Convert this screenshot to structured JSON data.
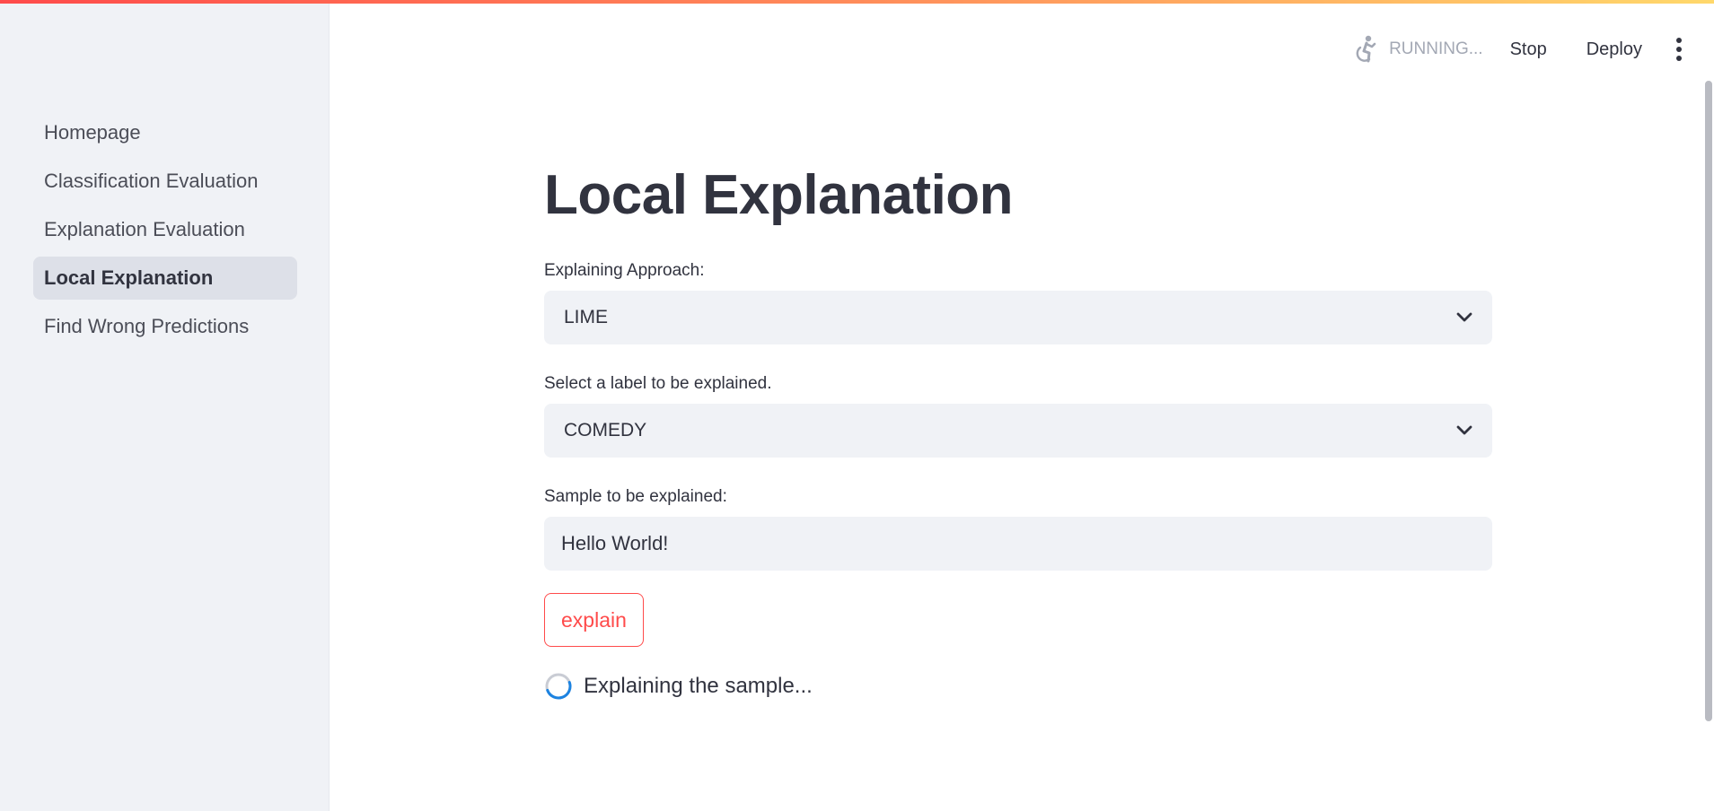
{
  "sidebar": {
    "items": [
      {
        "label": "Homepage"
      },
      {
        "label": "Classification Evaluation"
      },
      {
        "label": "Explanation Evaluation"
      },
      {
        "label": "Local Explanation",
        "active": true
      },
      {
        "label": "Find Wrong Predictions"
      }
    ]
  },
  "toolbar": {
    "status": "RUNNING...",
    "status_icon": "running-person-icon",
    "stop_label": "Stop",
    "deploy_label": "Deploy",
    "menu_icon": "kebab-menu-icon"
  },
  "main": {
    "title": "Local Explanation",
    "approach": {
      "label": "Explaining Approach:",
      "value": "LIME"
    },
    "label_select": {
      "label": "Select a label to be explained.",
      "value": "COMEDY"
    },
    "sample": {
      "label": "Sample to be explained:",
      "value": "Hello World!"
    },
    "explain_button": "explain",
    "spinner_text": "Explaining the sample..."
  },
  "colors": {
    "accent": "#ff4b4b",
    "sidebar_bg": "#f0f2f6",
    "active_item_bg": "#dde0e8",
    "text": "#31333f",
    "spinner": "#1c83e1"
  }
}
